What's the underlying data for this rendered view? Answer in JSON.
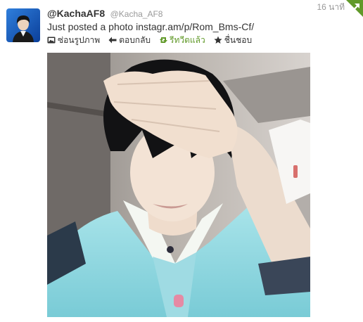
{
  "tweet": {
    "fullname": "@KachaAF8",
    "screen_name": "@Kacha_AF8",
    "timestamp": "16 นาที",
    "text_prefix": "Just posted a photo ",
    "link_text": "instagr.am/p/Rom_Bms-Cf/"
  },
  "actions": {
    "hide_photo": "ซ่อนรูปภาพ",
    "reply": "ตอบกลับ",
    "retweeted": "รีทวีตแล้ว",
    "favorite": "ชื่นชอบ"
  },
  "icons": {
    "retweet_corner": "retweet-corner-icon",
    "photo": "photo-icon",
    "reply": "reply-icon",
    "retweet": "retweet-icon",
    "favorite": "star-icon"
  },
  "colors": {
    "text": "#333333",
    "muted": "#999999",
    "retweet_green": "#609928"
  }
}
